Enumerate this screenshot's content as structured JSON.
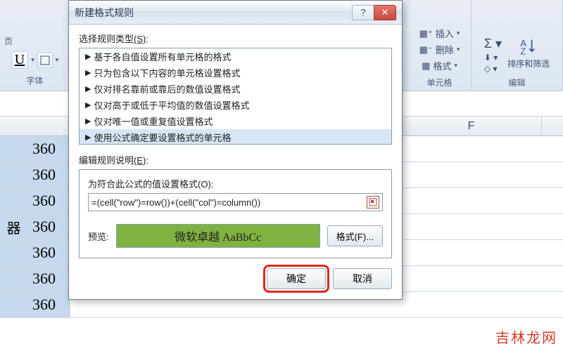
{
  "ribbon": {
    "font_group_label": "字体",
    "cells_group_label": "单元格",
    "edit_group_label": "编辑",
    "insert_label": "插入",
    "delete_label": "删除",
    "format_label": "格式",
    "sort_filter_label": "排序和筛选",
    "underline_glyph": "U",
    "page_hint": "页"
  },
  "sheet": {
    "col_f": "F",
    "left_label_fragment": "器",
    "value": "360"
  },
  "dialog": {
    "title": "新建格式规则",
    "help_glyph": "?",
    "close_glyph": "✕",
    "select_rule_type_label": "选择规则类型",
    "select_rule_type_hotkey": "(S)",
    "rules": [
      "基于各自值设置所有单元格的格式",
      "只为包含以下内容的单元格设置格式",
      "仅对排名靠前或靠后的数值设置格式",
      "仅对高于或低于平均值的数值设置格式",
      "仅对唯一值或重复值设置格式",
      "使用公式确定要设置格式的单元格"
    ],
    "edit_rule_desc_label": "编辑规则说明",
    "edit_rule_desc_hotkey": "(E)",
    "formula_label": "为符合此公式的值设置格式",
    "formula_hotkey": "(O)",
    "formula_value": "=(cell(\"row\")=row())+(cell(\"col\")=column())",
    "preview_label": "预览:",
    "preview_sample": "微软卓越  AaBbCc",
    "format_btn": "格式(F)...",
    "ok": "确定",
    "cancel": "取消"
  },
  "watermark": "吉林龙网"
}
